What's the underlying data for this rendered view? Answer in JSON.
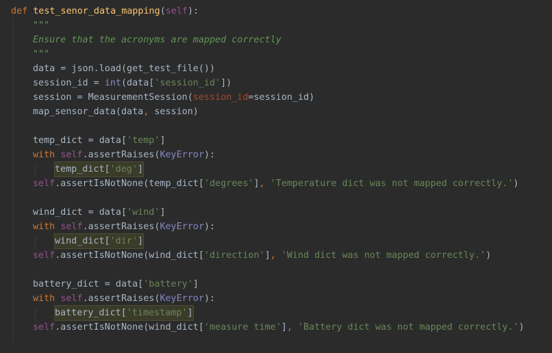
{
  "editor": {
    "language": "python",
    "colors": {
      "background": "#2b2b2b",
      "keyword": "#cc7832",
      "function": "#ffc66d",
      "self": "#94558d",
      "string": "#6a8759",
      "docstring": "#629755",
      "named_param": "#aa4926",
      "builtin": "#8888c6",
      "default": "#a9b7c6",
      "highlight": "#3b3b2a"
    },
    "lines": [
      {
        "indent": 0,
        "tokens": [
          [
            "kw",
            "def "
          ],
          [
            "fn",
            "test_senor_data_mapping"
          ],
          [
            "punct",
            "("
          ],
          [
            "self",
            "self"
          ],
          [
            "punct",
            "):"
          ]
        ]
      },
      {
        "indent": 1,
        "tokens": [
          [
            "doc",
            "\"\"\""
          ]
        ]
      },
      {
        "indent": 1,
        "tokens": [
          [
            "doc",
            "Ensure that the acronyms are mapped correctly"
          ]
        ]
      },
      {
        "indent": 1,
        "tokens": [
          [
            "doc",
            "\"\"\""
          ]
        ]
      },
      {
        "indent": 1,
        "tokens": [
          [
            "id",
            "data = json.load(get_test_file())"
          ]
        ]
      },
      {
        "indent": 1,
        "tokens": [
          [
            "id",
            "session_id = "
          ],
          [
            "builtin",
            "int"
          ],
          [
            "id",
            "(data["
          ],
          [
            "str",
            "'session_id'"
          ],
          [
            "id",
            "])"
          ]
        ]
      },
      {
        "indent": 1,
        "tokens": [
          [
            "id",
            "session = MeasurementSession("
          ],
          [
            "param",
            "session_id"
          ],
          [
            "id",
            "=session_id)"
          ]
        ]
      },
      {
        "indent": 1,
        "tokens": [
          [
            "id",
            "map_sensor_data(data"
          ],
          [
            "kw",
            ", "
          ],
          [
            "id",
            "session)"
          ]
        ]
      },
      {
        "indent": 1,
        "tokens": []
      },
      {
        "indent": 1,
        "tokens": [
          [
            "id",
            "temp_dict = data["
          ],
          [
            "str",
            "'temp'"
          ],
          [
            "id",
            "]"
          ]
        ]
      },
      {
        "indent": 1,
        "tokens": [
          [
            "kw",
            "with "
          ],
          [
            "self",
            "self"
          ],
          [
            "id",
            ".assertRaises("
          ],
          [
            "builtin",
            "KeyError"
          ],
          [
            "id",
            "):"
          ]
        ]
      },
      {
        "indent": 2,
        "highlight": true,
        "tokens": [
          [
            "id",
            "temp_dict["
          ],
          [
            "str",
            "'deg'"
          ],
          [
            "id",
            "]"
          ]
        ]
      },
      {
        "indent": 1,
        "tokens": [
          [
            "self",
            "self"
          ],
          [
            "id",
            ".assertIsNotNone(temp_dict["
          ],
          [
            "str",
            "'degrees'"
          ],
          [
            "id",
            "]"
          ],
          [
            "kw",
            ", "
          ],
          [
            "str",
            "'Temperature dict was not mapped correctly.'"
          ],
          [
            "id",
            ")"
          ]
        ]
      },
      {
        "indent": 1,
        "tokens": []
      },
      {
        "indent": 1,
        "tokens": [
          [
            "id",
            "wind_dict = data["
          ],
          [
            "str",
            "'wind'"
          ],
          [
            "id",
            "]"
          ]
        ]
      },
      {
        "indent": 1,
        "tokens": [
          [
            "kw",
            "with "
          ],
          [
            "self",
            "self"
          ],
          [
            "id",
            ".assertRaises("
          ],
          [
            "builtin",
            "KeyError"
          ],
          [
            "id",
            "):"
          ]
        ]
      },
      {
        "indent": 2,
        "highlight": true,
        "tokens": [
          [
            "id",
            "wind_dict["
          ],
          [
            "str",
            "'dir'"
          ],
          [
            "id",
            "]"
          ]
        ]
      },
      {
        "indent": 1,
        "tokens": [
          [
            "self",
            "self"
          ],
          [
            "id",
            ".assertIsNotNone(wind_dict["
          ],
          [
            "str",
            "'direction'"
          ],
          [
            "id",
            "]"
          ],
          [
            "kw",
            ", "
          ],
          [
            "str",
            "'Wind dict was not mapped correctly.'"
          ],
          [
            "id",
            ")"
          ]
        ]
      },
      {
        "indent": 1,
        "tokens": []
      },
      {
        "indent": 1,
        "tokens": [
          [
            "id",
            "battery_dict = data["
          ],
          [
            "str",
            "'battery'"
          ],
          [
            "id",
            "]"
          ]
        ]
      },
      {
        "indent": 1,
        "tokens": [
          [
            "kw",
            "with "
          ],
          [
            "self",
            "self"
          ],
          [
            "id",
            ".assertRaises("
          ],
          [
            "builtin",
            "KeyError"
          ],
          [
            "id",
            "):"
          ]
        ]
      },
      {
        "indent": 2,
        "highlight": true,
        "tokens": [
          [
            "id",
            "battery_dict["
          ],
          [
            "str",
            "'timestamp'"
          ],
          [
            "id",
            "]"
          ]
        ]
      },
      {
        "indent": 1,
        "tokens": [
          [
            "self",
            "self"
          ],
          [
            "id",
            ".assertIsNotNone(wind_dict["
          ],
          [
            "str",
            "'measure time'"
          ],
          [
            "id",
            "]"
          ],
          [
            "kw",
            ", "
          ],
          [
            "str",
            "'Battery dict was not mapped correctly.'"
          ],
          [
            "id",
            ")"
          ]
        ]
      }
    ]
  }
}
